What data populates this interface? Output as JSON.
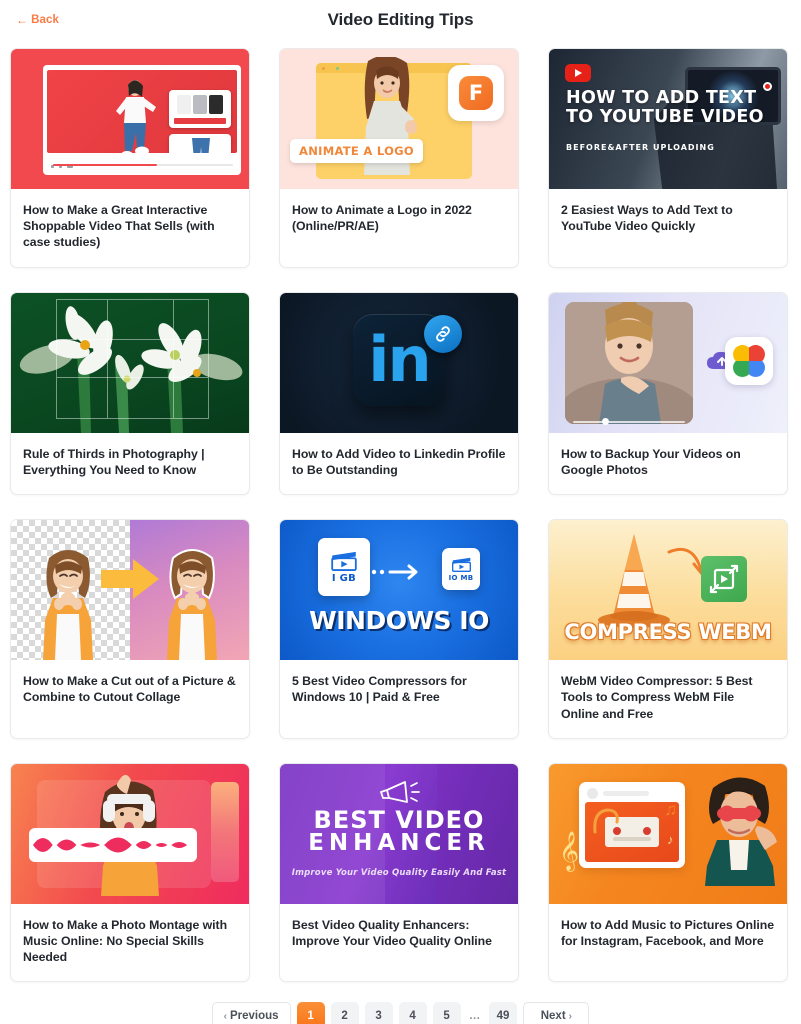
{
  "header": {
    "back_label": "Back",
    "back_icon": "arrow-left-icon",
    "title": "Video Editing Tips",
    "accent_color": "#f97b46"
  },
  "cards": [
    {
      "title": "How to Make a Great Interactive Shoppable Video That Sells (with case studies)",
      "thumb_style": "shoppable-video-red",
      "thumb_accent": "#f2494e",
      "thumb_text": ""
    },
    {
      "title": "How to Animate a Logo in 2022 (Online/PR/AE)",
      "thumb_style": "animate-logo-peach",
      "thumb_accent": "#fde3dc",
      "thumb_text": "ANIMATE A LOGO"
    },
    {
      "title": "2 Easiest Ways to Add Text to YouTube Video Quickly",
      "thumb_style": "youtube-text-dark",
      "thumb_accent": "#1d2633",
      "thumb_text": "HOW TO ADD TEXT TO YOUTUBE VIDEO",
      "thumb_subtext": "BEFORE&AFTER UPLOADING"
    },
    {
      "title": "Rule of Thirds in Photography | Everything You Need to Know",
      "thumb_style": "rule-of-thirds-green",
      "thumb_accent": "#0d5126",
      "thumb_text": ""
    },
    {
      "title": "How to Add Video to Linkedin Profile to Be Outstanding",
      "thumb_style": "linkedin-dark",
      "thumb_accent": "#2aa3ef",
      "thumb_text": "in"
    },
    {
      "title": "How to Backup Your Videos on Google Photos",
      "thumb_style": "google-photos-lavender",
      "thumb_accent": "#cfd2f0",
      "thumb_text": ""
    },
    {
      "title": "How to Make a Cut out of a Picture & Combine to Cutout Collage",
      "thumb_style": "cutout-collage",
      "thumb_accent": "#b07ad6",
      "thumb_text": ""
    },
    {
      "title": "5 Best Video Compressors for Windows 10 | Paid & Free",
      "thumb_style": "windows-compressor-blue",
      "thumb_accent": "#1a6fe0",
      "thumb_text": "WINDOWS IO",
      "thumb_label_big": "I GB",
      "thumb_label_small": "IO MB"
    },
    {
      "title": "WebM Video Compressor: 5 Best Tools to Compress WebM File Online and Free",
      "thumb_style": "compress-webm-yellow",
      "thumb_accent": "#fcdd9b",
      "thumb_text": "COMPRESS WEBM"
    },
    {
      "title": "How to Make a Photo Montage with Music Online: No Special Skills Needed",
      "thumb_style": "photo-montage-pink",
      "thumb_accent": "#ef2c5e",
      "thumb_text": ""
    },
    {
      "title": "Best Video Quality Enhancers: Improve Your Video Quality Online",
      "thumb_style": "video-enhancer-purple",
      "thumb_accent": "#7b35c4",
      "thumb_text": "BEST VIDEO",
      "thumb_text2": "ENHANCER",
      "thumb_subtext": "Improve Your Video Quality Easily And Fast"
    },
    {
      "title": "How to Add Music to Pictures Online for Instagram, Facebook, and More",
      "thumb_style": "add-music-orange",
      "thumb_accent": "#f5861f",
      "thumb_text": ""
    }
  ],
  "pagination": {
    "previous_label": "Previous",
    "next_label": "Next",
    "prev_icon": "chevron-left-icon",
    "next_icon": "chevron-right-icon",
    "pages": [
      "1",
      "2",
      "3",
      "4",
      "5",
      "…",
      "49"
    ],
    "active_page": "1",
    "active_color": "#f97316"
  }
}
